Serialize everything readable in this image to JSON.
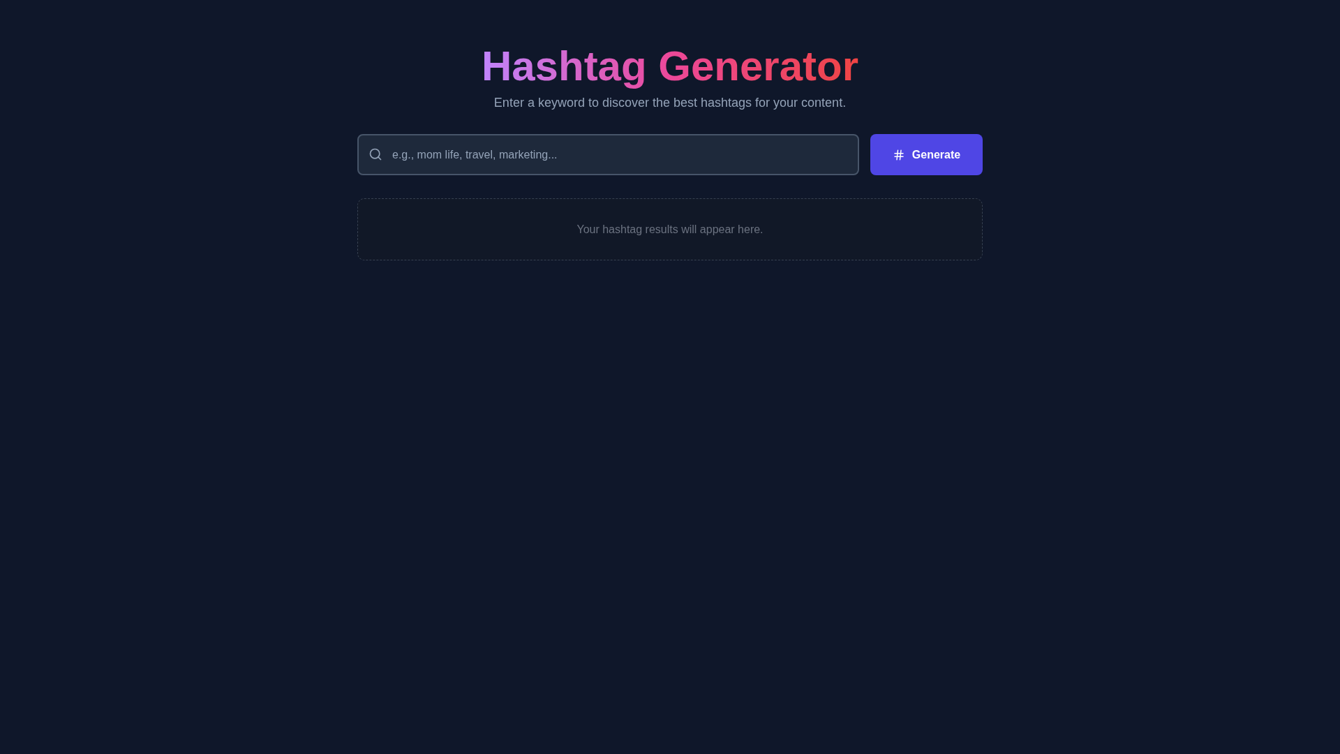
{
  "header": {
    "title": "Hashtag Generator",
    "subtitle": "Enter a keyword to discover the best hashtags for your content."
  },
  "search": {
    "placeholder": "e.g., mom life, travel, marketing..."
  },
  "button": {
    "label": "Generate"
  },
  "results": {
    "empty_message": "Your hashtag results will appear here."
  }
}
